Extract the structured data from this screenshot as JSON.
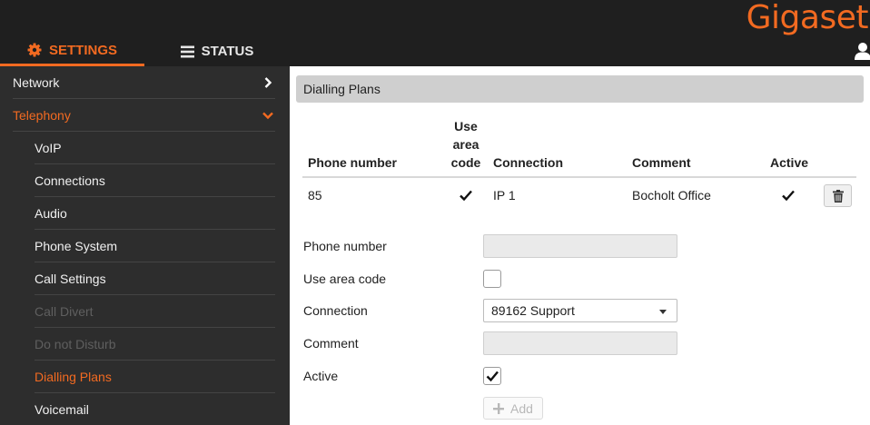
{
  "brand": {
    "logo_text": "Gigaset",
    "accent_color": "#f26a21"
  },
  "tabs": [
    {
      "label": "SETTINGS",
      "icon": "gear-icon",
      "active": true
    },
    {
      "label": "STATUS",
      "icon": "menu-icon",
      "active": false
    }
  ],
  "sidebar": {
    "items": [
      {
        "label": "Network",
        "level": "top",
        "state": "normal",
        "icon": "chevron-right-icon"
      },
      {
        "label": "Telephony",
        "level": "top",
        "state": "expanded",
        "icon": "chevron-down-icon"
      },
      {
        "label": "VoIP",
        "level": "sub",
        "state": "normal"
      },
      {
        "label": "Connections",
        "level": "sub",
        "state": "normal"
      },
      {
        "label": "Audio",
        "level": "sub",
        "state": "normal"
      },
      {
        "label": "Phone System",
        "level": "sub",
        "state": "normal"
      },
      {
        "label": "Call Settings",
        "level": "sub",
        "state": "normal"
      },
      {
        "label": "Call Divert",
        "level": "sub",
        "state": "disabled"
      },
      {
        "label": "Do not Disturb",
        "level": "sub",
        "state": "disabled"
      },
      {
        "label": "Dialling Plans",
        "level": "sub",
        "state": "selected"
      },
      {
        "label": "Voicemail",
        "level": "sub",
        "state": "normal"
      }
    ]
  },
  "main": {
    "section_title": "Dialling Plans",
    "table": {
      "headers": {
        "phone_number": "Phone number",
        "use_area_code": [
          "Use",
          "area",
          "code"
        ],
        "connection": "Connection",
        "comment": "Comment",
        "active": "Active"
      },
      "rows": [
        {
          "phone_number": "85",
          "use_area_code": true,
          "connection": "IP 1",
          "comment": "Bocholt Office",
          "active": true
        }
      ]
    },
    "form": {
      "phone_number_label": "Phone number",
      "phone_number_value": "",
      "use_area_code_label": "Use area code",
      "use_area_code_checked": false,
      "connection_label": "Connection",
      "connection_selected": "89162 Support",
      "comment_label": "Comment",
      "comment_value": "",
      "active_label": "Active",
      "active_checked": true,
      "add_label": "Add"
    }
  }
}
